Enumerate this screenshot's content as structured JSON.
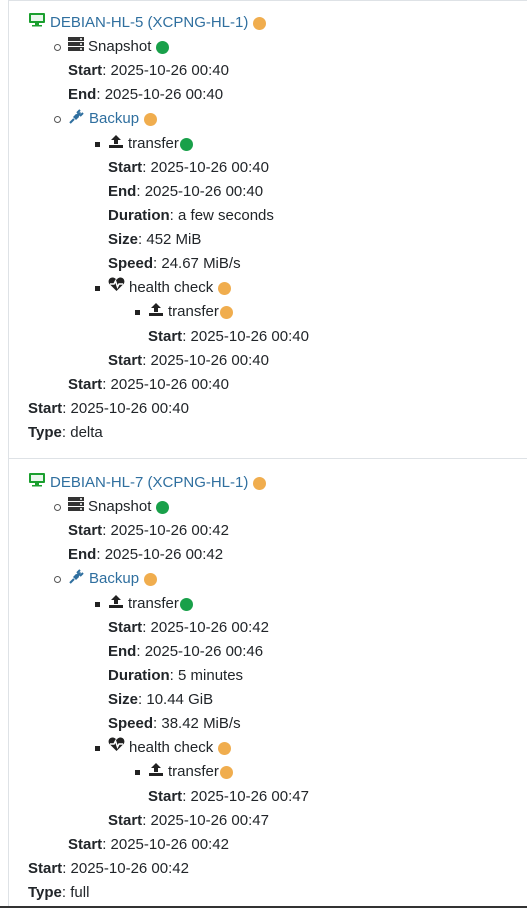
{
  "colors": {
    "link": "#2f6f9f",
    "status_green": "#19a04a",
    "status_orange": "#f0ad4e",
    "icon_green": "#1a9f2e"
  },
  "icons": {
    "vm": "monitor-icon",
    "snapshot": "server-icon",
    "backup": "plug-icon",
    "transfer": "upload-icon",
    "health": "heartbeat-icon"
  },
  "labels": {
    "start": "Start",
    "end": "End",
    "duration": "Duration",
    "size": "Size",
    "speed": "Speed",
    "type": "Type",
    "sep": ":"
  },
  "vms": [
    {
      "name": "DEBIAN-HL-5 (XCPNG-HL-1)",
      "snapshot": {
        "label": "Snapshot",
        "start": "2025-10-26 00:40",
        "end": "2025-10-26 00:40"
      },
      "backup": {
        "label": "Backup",
        "transfer": {
          "label": "transfer",
          "start": "2025-10-26 00:40",
          "end": "2025-10-26 00:40",
          "duration": "a few seconds",
          "size": "452 MiB",
          "speed": "24.67 MiB/s"
        },
        "health": {
          "label": "health check",
          "transfer_label": "transfer",
          "transfer_start": "2025-10-26 00:40",
          "start": "2025-10-26 00:40"
        },
        "start": "2025-10-26 00:40"
      },
      "start": "2025-10-26 00:40",
      "type": "delta"
    },
    {
      "name": "DEBIAN-HL-7 (XCPNG-HL-1)",
      "snapshot": {
        "label": "Snapshot",
        "start": "2025-10-26 00:42",
        "end": "2025-10-26 00:42"
      },
      "backup": {
        "label": "Backup",
        "transfer": {
          "label": "transfer",
          "start": "2025-10-26 00:42",
          "end": "2025-10-26 00:46",
          "duration": "5 minutes",
          "size": "10.44 GiB",
          "speed": "38.42 MiB/s"
        },
        "health": {
          "label": "health check",
          "transfer_label": "transfer",
          "transfer_start": "2025-10-26 00:47",
          "start": "2025-10-26 00:47"
        },
        "start": "2025-10-26 00:42"
      },
      "start": "2025-10-26 00:42",
      "type": "full"
    }
  ]
}
